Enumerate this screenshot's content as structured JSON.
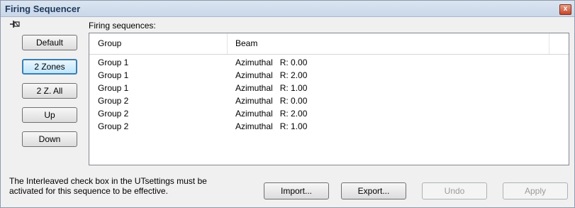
{
  "window": {
    "title": "Firing Sequencer",
    "close_glyph": "x"
  },
  "pin_glyph": "⊣⊠",
  "sequences_label": "Firing sequences:",
  "side_buttons": [
    {
      "label": "Default"
    },
    {
      "label": "2 Zones"
    },
    {
      "label": "2 Z. All"
    },
    {
      "label": "Up"
    },
    {
      "label": "Down"
    }
  ],
  "table": {
    "columns": [
      "Group",
      "Beam"
    ],
    "rows": [
      {
        "group": "Group 1",
        "beam": "Azimuthal   R: 0.00"
      },
      {
        "group": "Group 1",
        "beam": "Azimuthal   R: 2.00"
      },
      {
        "group": "Group 1",
        "beam": "Azimuthal   R: 1.00"
      },
      {
        "group": "Group 2",
        "beam": "Azimuthal   R: 0.00"
      },
      {
        "group": "Group 2",
        "beam": "Azimuthal   R: 2.00"
      },
      {
        "group": "Group 2",
        "beam": "Azimuthal   R: 1.00"
      }
    ]
  },
  "note": {
    "line1": "The Interleaved check box in the UTsettings must be",
    "line2": "activated for this sequence to be effective."
  },
  "bottom_buttons": {
    "import": "Import...",
    "export": "Export...",
    "undo": "Undo",
    "apply": "Apply"
  }
}
